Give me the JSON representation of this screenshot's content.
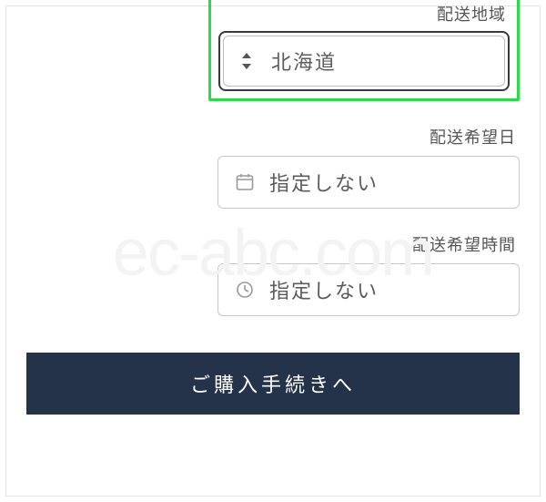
{
  "watermark": "ec-abc.com",
  "fields": {
    "region": {
      "label": "配送地域",
      "value": "北海道"
    },
    "date": {
      "label": "配送希望日",
      "value": "指定しない"
    },
    "time": {
      "label": "配送希望時間",
      "value": "指定しない"
    }
  },
  "cta": {
    "label": "ご購入手続きへ"
  },
  "colors": {
    "highlight": "#2bd94a",
    "cta_bg": "#24324a"
  }
}
